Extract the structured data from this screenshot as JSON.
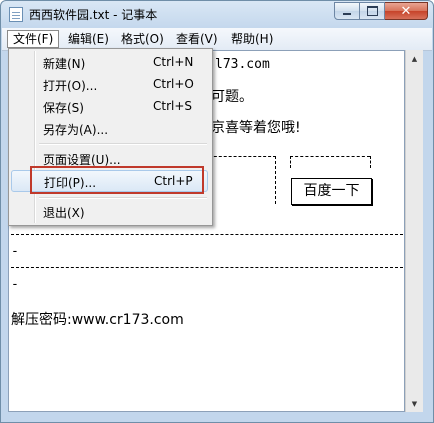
{
  "window": {
    "title": "西西软件园.txt - 记事本"
  },
  "menubar": {
    "file": "文件(F)",
    "edit": "编辑(E)",
    "format": "格式(O)",
    "view": "查看(V)",
    "help": "帮助(H)"
  },
  "file_menu": {
    "new": {
      "label": "新建(N)",
      "shortcut": "Ctrl+N"
    },
    "open": {
      "label": "打开(O)...",
      "shortcut": "Ctrl+O"
    },
    "save": {
      "label": "保存(S)",
      "shortcut": "Ctrl+S"
    },
    "save_as": {
      "label": "另存为(A)..."
    },
    "page_setup": {
      "label": "页面设置(U)..."
    },
    "print": {
      "label": "打印(P)...",
      "shortcut": "Ctrl+P"
    },
    "exit": {
      "label": "退出(X)"
    }
  },
  "editor": {
    "line1_visible": "l73.com",
    "line2_visible": "可题。",
    "line3_visible": "京喜等着您哦!",
    "dash_tail_1": "-",
    "dash_tail_2": "-",
    "button_label": "百度一下",
    "password_line": "解压密码:www.cr173.com"
  },
  "icons": {
    "app": "notepad-icon",
    "minimize": "minimize-icon",
    "maximize": "maximize-icon",
    "close": "close-icon",
    "scroll_up": "scroll-up-arrow-icon",
    "scroll_down": "scroll-down-arrow-icon"
  },
  "colors": {
    "highlight": "#c0392b",
    "close_button": "#c6432a"
  }
}
